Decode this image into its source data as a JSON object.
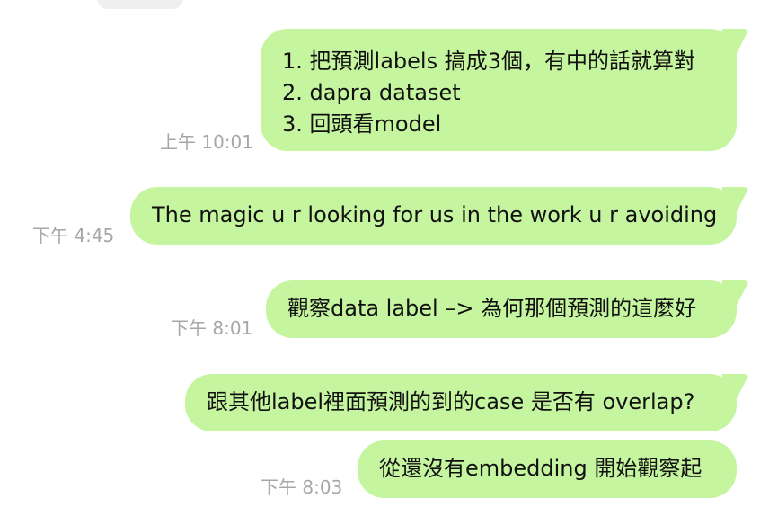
{
  "messages": [
    {
      "lines": [
        "1. 把預測labels 搞成3個，有中的話就算對",
        "2. dapra dataset",
        "3. 回頭看model"
      ],
      "time": "上午 10:01"
    },
    {
      "lines": [
        "The magic u r looking for us in the work u r avoiding"
      ],
      "time": "下午 4:45"
    },
    {
      "lines": [
        "觀察data label –> 為何那個預測的這麼好"
      ],
      "time": "下午 8:01"
    },
    {
      "lines": [
        "跟其他label裡面預測的到的case 是否有 overlap?"
      ]
    },
    {
      "lines": [
        "從還沒有embedding 開始觀察起"
      ],
      "time": "下午 8:03"
    }
  ],
  "colors": {
    "bubble": "#c6f59f",
    "timestamp": "#a7a7a7"
  }
}
